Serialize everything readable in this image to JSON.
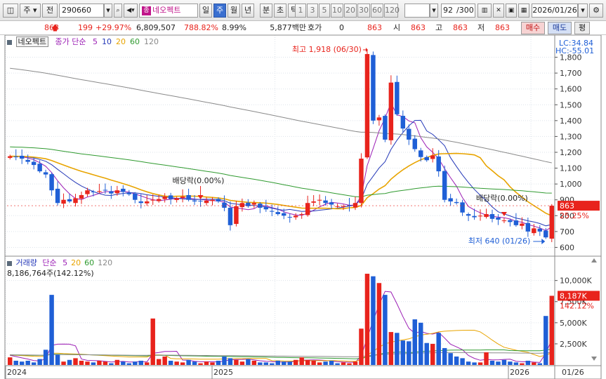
{
  "toolbar": {
    "market": "주",
    "exchange": "전",
    "code": "290660",
    "stock_name": "네오펙트",
    "stock_badge": "종",
    "periods": [
      "일",
      "주",
      "월",
      "년",
      "분",
      "초",
      "틱"
    ],
    "selected_period": "주",
    "intervals": [
      "1",
      "3",
      "5",
      "10",
      "20",
      "30",
      "60",
      "120"
    ],
    "count": "92",
    "count_total": "/300",
    "date": "2026/01/26"
  },
  "quote": {
    "price": "863",
    "change": "199",
    "change_pct": "+29.97%",
    "volume": "6,809,507",
    "volume_ratio": "788.82%",
    "turnover_pct": "8.99%",
    "amount": "5,877백만",
    "hoga_label": "호가",
    "hoga_value": "0",
    "last": "863",
    "open_label": "시",
    "open": "863",
    "high_label": "고",
    "high": "863",
    "low_label": "저",
    "low": "863",
    "buy_label": "매수",
    "sell_label": "매도",
    "eval_label": "평"
  },
  "price_panel": {
    "name": "네오펙트",
    "legend_prefix": "종가 단순",
    "ma_labels": [
      "5",
      "10",
      "20",
      "60",
      "120"
    ],
    "ma_colors": [
      "#9c1fb5",
      "#2438b8",
      "#e8a400",
      "#2f9a2f",
      "#8a8a8a"
    ],
    "lc": "LC:34.84",
    "hc": "HC:-55.01",
    "price_tag": "863",
    "pct_tag": "25.25%",
    "high_note": "최고 1,918 (06/30)",
    "low_note": "최저 640 (01/26)",
    "dividend_1": "배당락(0.00%)",
    "dividend_2": "배당락(0.00%)"
  },
  "volume_panel": {
    "title": "거래량",
    "legend_prefix": "단순",
    "ma_labels": [
      "5",
      "20",
      "60",
      "120"
    ],
    "ma_colors": [
      "#9c1fb5",
      "#e8a400",
      "#2f9a2f",
      "#8a8a8a"
    ],
    "info": "8,186,764주(142.12%)",
    "tag_value": "8,187K",
    "tag_pct": "142.12%"
  },
  "x_axis": {
    "labels": [
      "2024",
      "2025",
      "2026",
      "01/26"
    ]
  },
  "chart_data": {
    "type": "candlestick",
    "price_axis": {
      "min": 600,
      "max": 1800,
      "ticks": [
        600,
        700,
        800,
        900,
        1000,
        1100,
        1200,
        1300,
        1400,
        1500,
        1600,
        1700,
        1800
      ]
    },
    "volume_axis": {
      "ticks": [
        "2,500K",
        "5,000K",
        "7,500K",
        "10,000K"
      ]
    },
    "closes": [
      1175,
      1172,
      1160,
      1140,
      1120,
      1080,
      1060,
      960,
      880,
      900,
      890,
      910,
      930,
      960,
      950,
      955,
      960,
      940,
      960,
      950,
      935,
      900,
      880,
      890,
      900,
      905,
      920,
      905,
      910,
      920,
      900,
      890,
      890,
      895,
      900,
      890,
      850,
      740,
      860,
      880,
      860,
      880,
      850,
      840,
      825,
      810,
      800,
      790,
      800,
      810,
      880,
      890,
      900,
      880,
      870,
      860,
      860,
      860,
      880,
      1160,
      1820,
      1400,
      1420,
      1280,
      1640,
      1440,
      1350,
      1280,
      1220,
      1170,
      1150,
      1180,
      1080,
      900,
      890,
      880,
      820,
      800,
      790,
      800,
      810,
      780,
      775,
      770,
      760,
      740,
      750,
      700,
      720,
      700,
      663,
      863
    ],
    "volumes": [
      0.9,
      0.5,
      0.4,
      0.5,
      0.3,
      0.7,
      1.8,
      8.3,
      1.2,
      0.4,
      0.6,
      0.8,
      0.5,
      0.4,
      0.3,
      0.5,
      0.4,
      0.2,
      0.6,
      0.4,
      0.2,
      0.4,
      0.5,
      0.3,
      5.5,
      0.7,
      1.0,
      0.5,
      0.4,
      0.3,
      0.6,
      0.4,
      0.2,
      0.4,
      0.3,
      0.5,
      1.0,
      0.8,
      0.6,
      0.4,
      0.7,
      0.5,
      0.3,
      0.3,
      0.2,
      0.5,
      0.4,
      0.4,
      0.6,
      0.9,
      0.6,
      0.5,
      0.3,
      0.4,
      0.5,
      0.2,
      0.3,
      0.2,
      0.4,
      4.3,
      10.8,
      10.5,
      9.7,
      8.3,
      3.9,
      3.8,
      2.9,
      2.8,
      5.4,
      5.0,
      2.6,
      2.5,
      3.8,
      2.0,
      1.4,
      1.0,
      0.8,
      0.4,
      0.3,
      0.3,
      1.5,
      0.5,
      0.4,
      0.6,
      0.4,
      0.3,
      0.2,
      0.5,
      0.3,
      0.2,
      5.8,
      8.19
    ]
  }
}
